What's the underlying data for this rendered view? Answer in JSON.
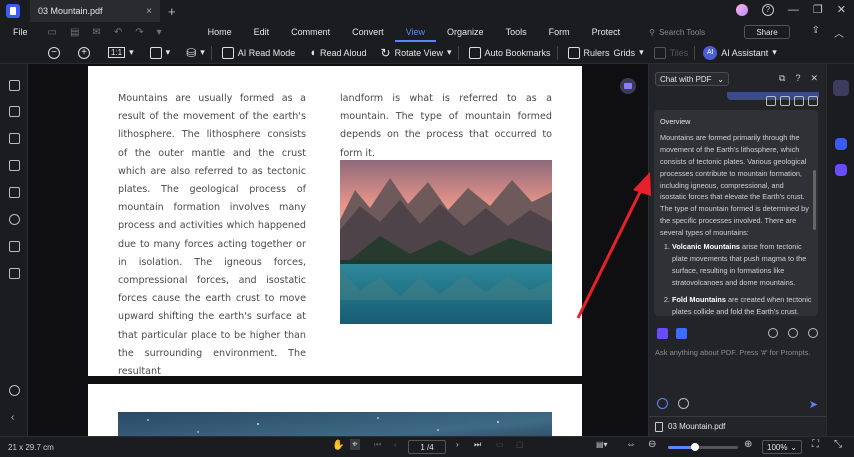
{
  "window": {
    "tab_title": "03 Mountain.pdf",
    "tab_close": "×",
    "new_tab": "+",
    "controls": [
      "?",
      "—",
      "❐",
      "✕"
    ]
  },
  "menu": {
    "file": "File",
    "items": [
      "Home",
      "Edit",
      "Comment",
      "Convert",
      "View",
      "Organize",
      "Tools",
      "Form",
      "Protect"
    ],
    "active": "View",
    "search_placeholder": "Search Tools",
    "share": "Share"
  },
  "toolbar": {
    "zoom_out": "−",
    "zoom_in": "+",
    "page_fit": "1:1",
    "ai_read_mode": "AI Read Mode",
    "read_aloud": "Read Aloud",
    "rotate_view": "Rotate View",
    "auto_bookmarks": "Auto Bookmarks",
    "rulers": "Rulers",
    "grids": "Grids",
    "tiles": "Tiles",
    "ai_assistant": "AI Assistant",
    "ai_badge": "AI"
  },
  "document": {
    "col_left": "Mountains are usually formed as a result of the movement of the earth's lithosphere. The lithosphere consists of the outer mantle and the crust which are also referred to as tectonic plates. The geological process of mountain formation involves many process and activities which happened due to many forces acting together or in isolation. The igneous forces, compressional forces, and isostatic forces cause the earth crust to move upward shifting the earth's surface at that particular place to be higher than the surrounding environment. The resultant",
    "col_right": "landform is what is referred to as a mountain. The type of mountain formed depends on the process that occurred to form it."
  },
  "ai_panel": {
    "mode": "Chat with PDF",
    "overview_title": "Overview",
    "overview_body": "Mountains are formed primarily through the movement of the Earth's lithosphere, which consists of tectonic plates. Various geological processes contribute to mountain formation, including igneous, compressional, and isostatic forces that elevate the Earth's crust. The type of mountain formed is determined by the specific processes involved. There are several types of mountains:",
    "list": [
      {
        "term": "Volcanic Mountains",
        "text": " arise from tectonic plate movements that push magma to the surface, resulting in formations like stratovolcanoes and dome mountains."
      },
      {
        "term": "Fold Mountains",
        "text": " are created when tectonic plates collide and fold the Earth's crust."
      }
    ],
    "input_placeholder": "Ask anything about PDF. Press '#' for Prompts.",
    "file_name": "03 Mountain.pdf",
    "send_icon": "➤"
  },
  "status": {
    "page_size": "21 x 29.7 cm",
    "page_indicator": "1 /4",
    "zoom": "100%",
    "zoom_level": 0.38
  },
  "colors": {
    "accent": "#5c86ff",
    "panel_bg": "#232428",
    "chrome_bg": "#1b1c1f",
    "annotation_arrow": "#e8202a"
  }
}
